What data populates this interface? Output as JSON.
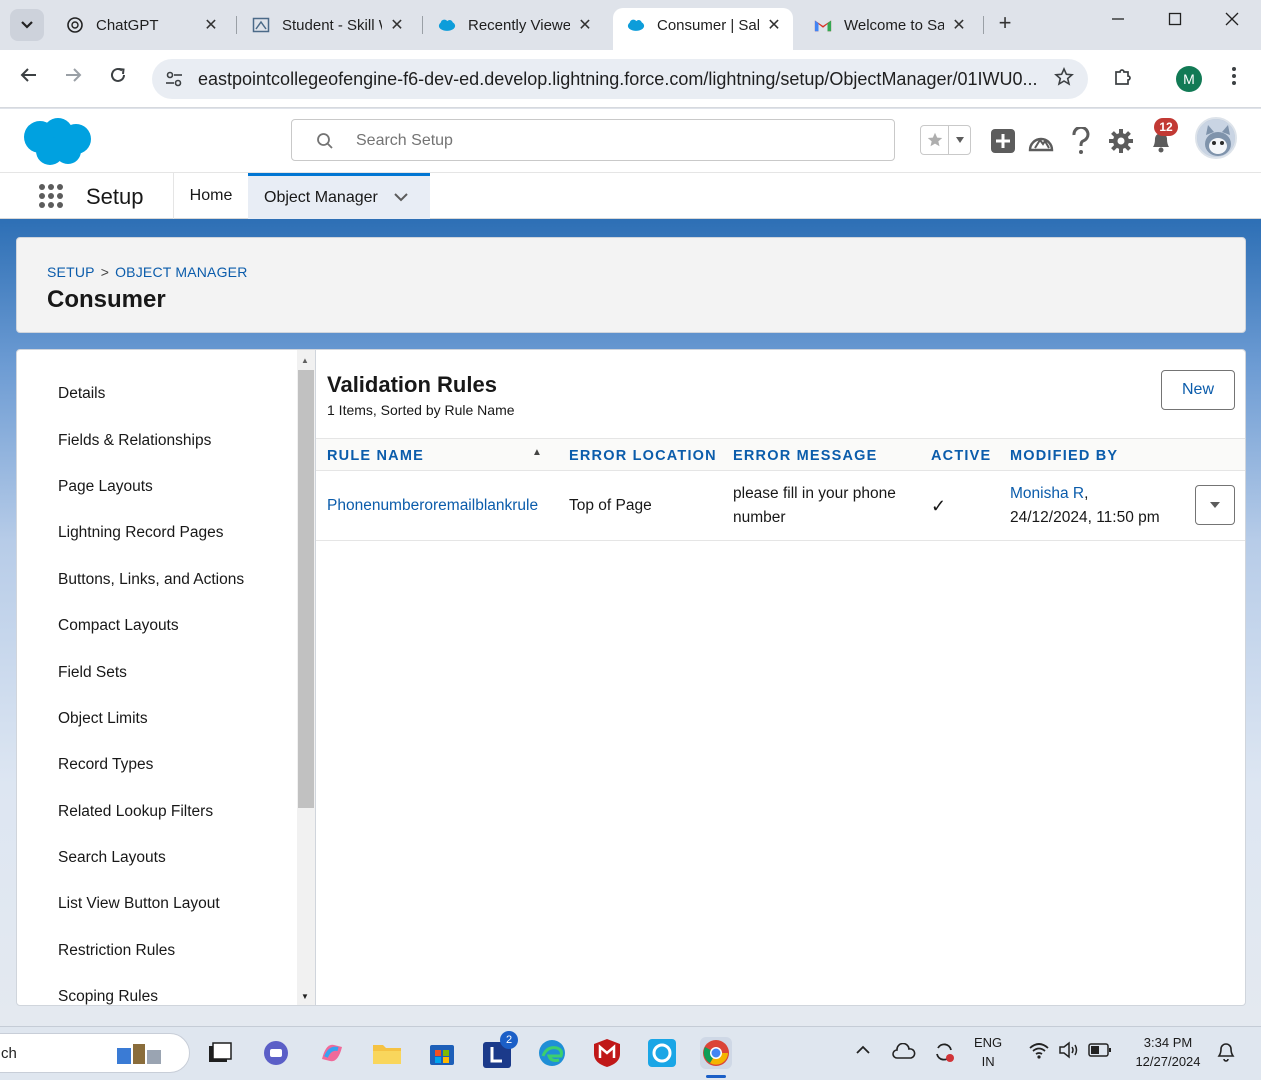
{
  "browser": {
    "tabs": [
      {
        "title": "ChatGPT",
        "icon": "chatgpt-icon"
      },
      {
        "title": "Student - Skill Wallet",
        "icon": "student-icon"
      },
      {
        "title": "Recently Viewed",
        "icon": "salesforce-icon"
      },
      {
        "title": "Consumer | Salesforce",
        "icon": "salesforce-icon",
        "active": true
      },
      {
        "title": "Welcome to Salesforce",
        "icon": "gmail-icon"
      }
    ],
    "close_glyph": "✕",
    "new_tab_glyph": "+",
    "url": "eastpointcollegeofengine-f6-dev-ed.develop.lightning.force.com/lightning/setup/ObjectManager/01IWU0...",
    "profile_initial": "M"
  },
  "sf": {
    "search_placeholder": "Search Setup",
    "notification_count": "12",
    "app_name": "Setup",
    "nav": {
      "home": "Home",
      "object_manager": "Object Manager"
    },
    "colors": {
      "brand": "#0176d3",
      "link": "#0b5cab",
      "badge": "#c23934"
    }
  },
  "page": {
    "breadcrumb": [
      "SETUP",
      "OBJECT MANAGER"
    ],
    "breadcrumb_sep": ">",
    "object_title": "Consumer"
  },
  "sidebar": {
    "items": [
      "Details",
      "Fields & Relationships",
      "Page Layouts",
      "Lightning Record Pages",
      "Buttons, Links, and Actions",
      "Compact Layouts",
      "Field Sets",
      "Object Limits",
      "Record Types",
      "Related Lookup Filters",
      "Search Layouts",
      "List View Button Layout",
      "Restriction Rules",
      "Scoping Rules"
    ]
  },
  "main": {
    "title": "Validation Rules",
    "subtitle": "1 Items, Sorted by Rule Name",
    "new_button": "New",
    "columns": [
      "Rule Name",
      "Error Location",
      "Error Message",
      "Active",
      "Modified By"
    ],
    "rows": [
      {
        "rule_name": "Phonenumberoremailblankrule",
        "error_location": "Top of Page",
        "error_message_line1": "please fill in your phone",
        "error_message_line2": "number",
        "active": true,
        "active_glyph": "✓",
        "modified_by_name": "Monisha R",
        "modified_by_sep": ",",
        "modified_at": "24/12/2024, 11:50 pm"
      }
    ]
  },
  "taskbar": {
    "search_text": "ch",
    "lang_line1": "ENG",
    "lang_line2": "IN",
    "time": "3:34 PM",
    "date": "12/27/2024",
    "app_badge": "2"
  }
}
